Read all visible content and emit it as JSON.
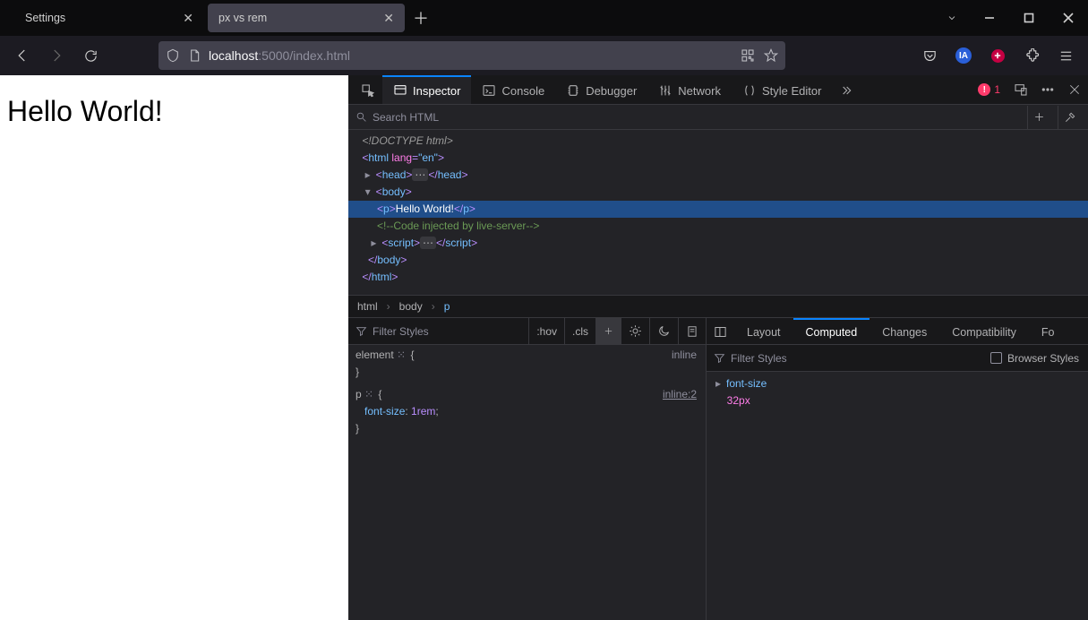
{
  "tabs": [
    {
      "title": "Settings",
      "active": false
    },
    {
      "title": "px vs rem",
      "active": true
    }
  ],
  "url": {
    "host": "localhost",
    "port": ":5000",
    "path": "/index.html"
  },
  "page": {
    "heading": "Hello World!"
  },
  "devtools": {
    "tools": {
      "inspector": "Inspector",
      "console": "Console",
      "debugger": "Debugger",
      "network": "Network",
      "style_editor": "Style Editor"
    },
    "error_count": "1",
    "search_placeholder": "Search HTML",
    "breadcrumb": [
      "html",
      "body",
      "p"
    ],
    "markup": {
      "doctype": "<!DOCTYPE html>",
      "html_open": "html",
      "lang_attr": "lang",
      "lang_val": "\"en\"",
      "head": "head",
      "body": "body",
      "p_open": "<p>",
      "p_text": "Hello World!",
      "p_close": "</p>",
      "comment": "<!--Code injected by live-server-->",
      "script": "script",
      "body_close": "body",
      "html_close": "html"
    },
    "rules": {
      "filter_placeholder": "Filter Styles",
      "hov": ":hov",
      "cls": ".cls",
      "element_sel": "element",
      "element_src": "inline",
      "p_sel": "p",
      "p_src": "inline:2",
      "p_prop": "font-size",
      "p_val": "1rem"
    },
    "computed": {
      "tabs": {
        "layout": "Layout",
        "computed": "Computed",
        "changes": "Changes",
        "compat": "Compatibility",
        "fonts": "Fo"
      },
      "filter_placeholder": "Filter Styles",
      "browser_styles": "Browser Styles",
      "prop": "font-size",
      "val": "32px"
    }
  }
}
